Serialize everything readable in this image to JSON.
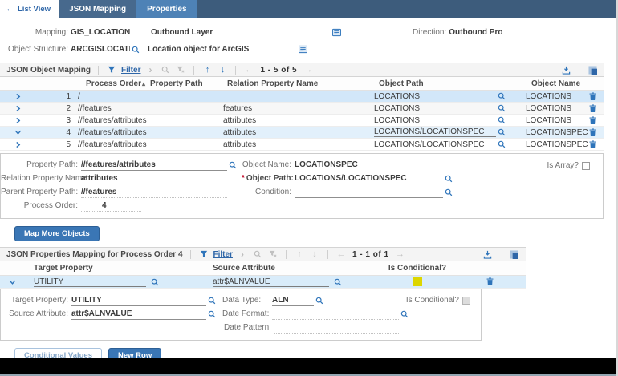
{
  "topbar": {
    "back": "List View",
    "tabs": [
      {
        "label": "JSON Mapping",
        "active": false
      },
      {
        "label": "Properties",
        "active": true
      }
    ]
  },
  "header": {
    "mapping": {
      "label": "Mapping:",
      "value": "GIS_LOCATION",
      "description": "Outbound Layer"
    },
    "direction": {
      "label": "Direction:",
      "value": "Outbound Proce"
    },
    "object_structure": {
      "label": "Object Structure:",
      "value": "ARCGISLOCATIO",
      "description": "Location object for ArcGIS"
    }
  },
  "object_mapping": {
    "title": "JSON Object Mapping",
    "filter": "Filter",
    "pagination": "1 - 5 of 5",
    "columns": {
      "process_order": "Process Order",
      "property_path": "Property Path",
      "relation_property_name": "Relation Property Name",
      "object_path": "Object Path",
      "object_name": "Object Name"
    },
    "rows": [
      {
        "process_order": "1",
        "property_path": "/",
        "relation_property_name": "",
        "object_path": "LOCATIONS",
        "object_name": "LOCATIONS"
      },
      {
        "process_order": "2",
        "property_path": "//features",
        "relation_property_name": "features",
        "object_path": "LOCATIONS",
        "object_name": "LOCATIONS"
      },
      {
        "process_order": "3",
        "property_path": "//features/attributes",
        "relation_property_name": "attributes",
        "object_path": "LOCATIONS",
        "object_name": "LOCATIONS"
      },
      {
        "process_order": "4",
        "property_path": "//features/attributes",
        "relation_property_name": "attributes",
        "object_path": "LOCATIONS/LOCATIONSPEC",
        "object_name": "LOCATIONSPEC"
      },
      {
        "process_order": "5",
        "property_path": "//features/attributes",
        "relation_property_name": "attributes",
        "object_path": "LOCATIONS/LOCATIONSPEC",
        "object_name": "LOCATIONSPEC"
      }
    ],
    "detail": {
      "property_path": {
        "label": "Property Path:",
        "value": "//features/attributes"
      },
      "relation_property_name": {
        "label": "Relation Property Name:",
        "value": "attributes"
      },
      "parent_property_path": {
        "label": "Parent Property Path:",
        "value": "//features"
      },
      "process_order": {
        "label": "Process Order:",
        "value": "4"
      },
      "object_name": {
        "label": "Object Name:",
        "value": "LOCATIONSPEC"
      },
      "object_path": {
        "label": "Object Path:",
        "value": "LOCATIONS/LOCATIONSPEC",
        "required": true
      },
      "condition": {
        "label": "Condition:",
        "value": ""
      },
      "is_array": {
        "label": "Is Array?",
        "checked": false
      }
    }
  },
  "map_more_objects_button": "Map More Objects",
  "properties_mapping": {
    "title": "JSON Properties Mapping for Process Order 4",
    "filter": "Filter",
    "pagination": "1 - 1 of 1",
    "columns": {
      "target_property": "Target Property",
      "source_attribute": "Source Attribute",
      "is_conditional": "Is Conditional?"
    },
    "rows": [
      {
        "target_property": "UTILITY",
        "source_attribute": "attr$ALNVALUE",
        "is_conditional": true
      }
    ],
    "detail": {
      "target_property": {
        "label": "Target Property:",
        "value": "UTILITY"
      },
      "source_attribute": {
        "label": "Source Attribute:",
        "value": "attr$ALNVALUE"
      },
      "data_type": {
        "label": "Data Type:",
        "value": "ALN"
      },
      "date_format": {
        "label": "Date Format:",
        "value": ""
      },
      "date_pattern": {
        "label": "Date Pattern:",
        "value": ""
      },
      "is_conditional": {
        "label": "Is Conditional?",
        "checked": false
      }
    }
  },
  "footer": {
    "conditional_values": "Conditional Values",
    "new_row": "New Row"
  },
  "colors": {
    "topbar": "#3d5c7c",
    "tab_inactive": "#47698d",
    "tab_active": "#4e82b6",
    "accent": "#2e74ba",
    "selected_row": "#d2e7f9",
    "expanded_row": "#e2f0fb",
    "conditional_indicator": "#ddd600"
  },
  "icons": {
    "back-arrow-icon": "←",
    "filter-icon": "funnel",
    "open-filter-icon": "›",
    "search-icon": "magnifier",
    "clear-filter-icon": "funnel-x",
    "move-up-icon": "↑",
    "move-down-icon": "↓",
    "prev-page-icon": "←",
    "next-page-icon": "→",
    "download-icon": "tray-arrow-down",
    "maximize-icon": "overlapping-squares",
    "expand-row-icon": "chevron-right",
    "collapse-row-icon": "chevron-down",
    "delete-icon": "trash",
    "long-description-icon": "lined-box",
    "sort-ascending-icon": "▴"
  }
}
